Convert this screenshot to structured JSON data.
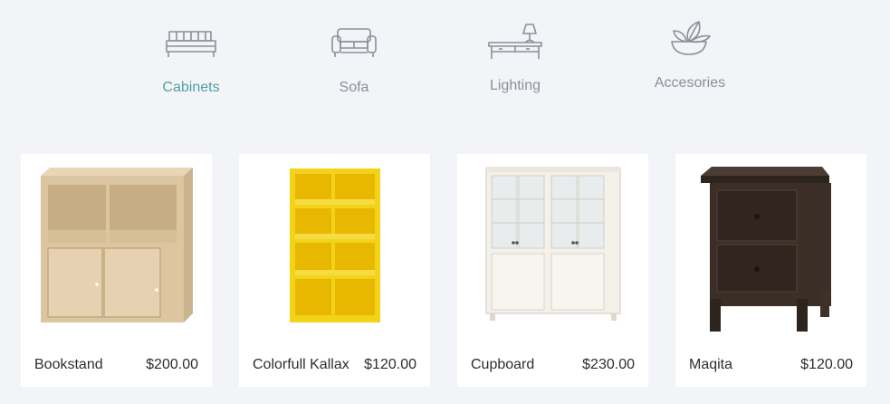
{
  "categories": [
    {
      "label": "Cabinets",
      "icon": "bed-icon",
      "active": true
    },
    {
      "label": "Sofa",
      "icon": "sofa-icon",
      "active": false
    },
    {
      "label": "Lighting",
      "icon": "lamp-table-icon",
      "active": false
    },
    {
      "label": "Accesories",
      "icon": "plant-bowl-icon",
      "active": false
    }
  ],
  "colors": {
    "active_category": "#4e9fa3",
    "inactive_category": "#8a9099",
    "icon_stroke": "#8a9099",
    "page_background": "#f3f4f8",
    "card_background": "#ffffff",
    "text": "#2a2e33"
  },
  "products": [
    {
      "name": "Bookstand",
      "price": "$200.00",
      "image": "light-wood-shelf-with-doors"
    },
    {
      "name": "Colorfull Kallax",
      "price": "$120.00",
      "image": "yellow-shelving-unit"
    },
    {
      "name": "Cupboard",
      "price": "$230.00",
      "image": "white-glass-door-cabinet"
    },
    {
      "name": "Maqita",
      "price": "$120.00",
      "image": "dark-nightstand"
    }
  ]
}
